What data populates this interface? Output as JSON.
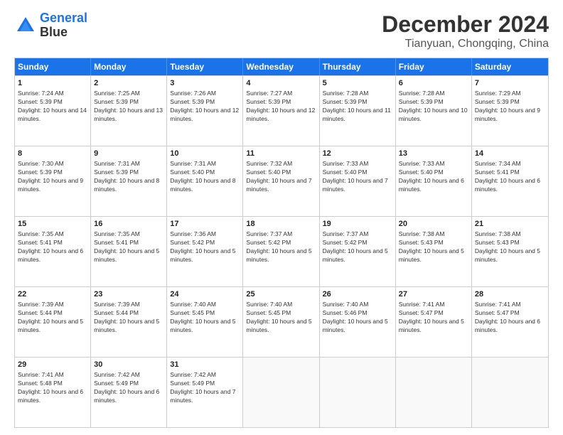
{
  "header": {
    "logo_line1": "General",
    "logo_line2": "Blue",
    "title": "December 2024",
    "subtitle": "Tianyuan, Chongqing, China"
  },
  "weekdays": [
    "Sunday",
    "Monday",
    "Tuesday",
    "Wednesday",
    "Thursday",
    "Friday",
    "Saturday"
  ],
  "weeks": [
    [
      {
        "day": "1",
        "sunrise": "7:24 AM",
        "sunset": "5:39 PM",
        "daylight": "10 hours and 14 minutes."
      },
      {
        "day": "2",
        "sunrise": "7:25 AM",
        "sunset": "5:39 PM",
        "daylight": "10 hours and 13 minutes."
      },
      {
        "day": "3",
        "sunrise": "7:26 AM",
        "sunset": "5:39 PM",
        "daylight": "10 hours and 12 minutes."
      },
      {
        "day": "4",
        "sunrise": "7:27 AM",
        "sunset": "5:39 PM",
        "daylight": "10 hours and 12 minutes."
      },
      {
        "day": "5",
        "sunrise": "7:28 AM",
        "sunset": "5:39 PM",
        "daylight": "10 hours and 11 minutes."
      },
      {
        "day": "6",
        "sunrise": "7:28 AM",
        "sunset": "5:39 PM",
        "daylight": "10 hours and 10 minutes."
      },
      {
        "day": "7",
        "sunrise": "7:29 AM",
        "sunset": "5:39 PM",
        "daylight": "10 hours and 9 minutes."
      }
    ],
    [
      {
        "day": "8",
        "sunrise": "7:30 AM",
        "sunset": "5:39 PM",
        "daylight": "10 hours and 9 minutes."
      },
      {
        "day": "9",
        "sunrise": "7:31 AM",
        "sunset": "5:39 PM",
        "daylight": "10 hours and 8 minutes."
      },
      {
        "day": "10",
        "sunrise": "7:31 AM",
        "sunset": "5:40 PM",
        "daylight": "10 hours and 8 minutes."
      },
      {
        "day": "11",
        "sunrise": "7:32 AM",
        "sunset": "5:40 PM",
        "daylight": "10 hours and 7 minutes."
      },
      {
        "day": "12",
        "sunrise": "7:33 AM",
        "sunset": "5:40 PM",
        "daylight": "10 hours and 7 minutes."
      },
      {
        "day": "13",
        "sunrise": "7:33 AM",
        "sunset": "5:40 PM",
        "daylight": "10 hours and 6 minutes."
      },
      {
        "day": "14",
        "sunrise": "7:34 AM",
        "sunset": "5:41 PM",
        "daylight": "10 hours and 6 minutes."
      }
    ],
    [
      {
        "day": "15",
        "sunrise": "7:35 AM",
        "sunset": "5:41 PM",
        "daylight": "10 hours and 6 minutes."
      },
      {
        "day": "16",
        "sunrise": "7:35 AM",
        "sunset": "5:41 PM",
        "daylight": "10 hours and 5 minutes."
      },
      {
        "day": "17",
        "sunrise": "7:36 AM",
        "sunset": "5:42 PM",
        "daylight": "10 hours and 5 minutes."
      },
      {
        "day": "18",
        "sunrise": "7:37 AM",
        "sunset": "5:42 PM",
        "daylight": "10 hours and 5 minutes."
      },
      {
        "day": "19",
        "sunrise": "7:37 AM",
        "sunset": "5:42 PM",
        "daylight": "10 hours and 5 minutes."
      },
      {
        "day": "20",
        "sunrise": "7:38 AM",
        "sunset": "5:43 PM",
        "daylight": "10 hours and 5 minutes."
      },
      {
        "day": "21",
        "sunrise": "7:38 AM",
        "sunset": "5:43 PM",
        "daylight": "10 hours and 5 minutes."
      }
    ],
    [
      {
        "day": "22",
        "sunrise": "7:39 AM",
        "sunset": "5:44 PM",
        "daylight": "10 hours and 5 minutes."
      },
      {
        "day": "23",
        "sunrise": "7:39 AM",
        "sunset": "5:44 PM",
        "daylight": "10 hours and 5 minutes."
      },
      {
        "day": "24",
        "sunrise": "7:40 AM",
        "sunset": "5:45 PM",
        "daylight": "10 hours and 5 minutes."
      },
      {
        "day": "25",
        "sunrise": "7:40 AM",
        "sunset": "5:45 PM",
        "daylight": "10 hours and 5 minutes."
      },
      {
        "day": "26",
        "sunrise": "7:40 AM",
        "sunset": "5:46 PM",
        "daylight": "10 hours and 5 minutes."
      },
      {
        "day": "27",
        "sunrise": "7:41 AM",
        "sunset": "5:47 PM",
        "daylight": "10 hours and 5 minutes."
      },
      {
        "day": "28",
        "sunrise": "7:41 AM",
        "sunset": "5:47 PM",
        "daylight": "10 hours and 6 minutes."
      }
    ],
    [
      {
        "day": "29",
        "sunrise": "7:41 AM",
        "sunset": "5:48 PM",
        "daylight": "10 hours and 6 minutes."
      },
      {
        "day": "30",
        "sunrise": "7:42 AM",
        "sunset": "5:49 PM",
        "daylight": "10 hours and 6 minutes."
      },
      {
        "day": "31",
        "sunrise": "7:42 AM",
        "sunset": "5:49 PM",
        "daylight": "10 hours and 7 minutes."
      },
      null,
      null,
      null,
      null
    ]
  ]
}
